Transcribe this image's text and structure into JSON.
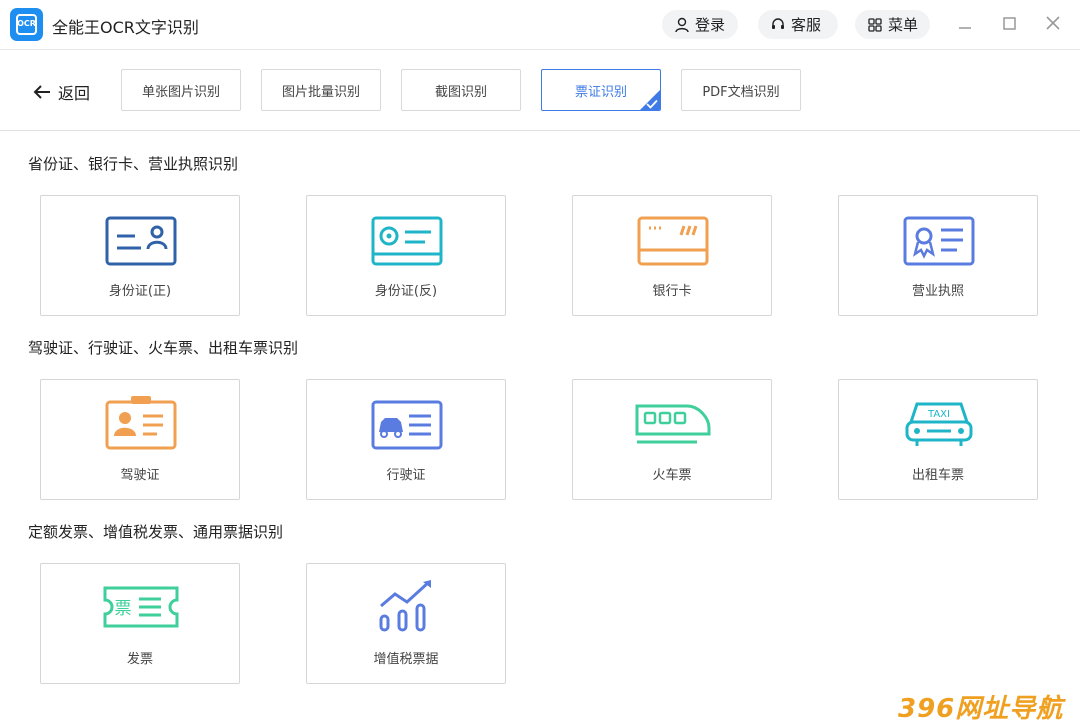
{
  "app": {
    "title": "全能王OCR文字识别",
    "logo_text": "OCR",
    "login_label": "登录",
    "service_label": "客服",
    "menu_label": "菜单"
  },
  "toolbar": {
    "back_label": "返回",
    "tabs": [
      {
        "label": "单张图片识别",
        "active": false
      },
      {
        "label": "图片批量识别",
        "active": false
      },
      {
        "label": "截图识别",
        "active": false
      },
      {
        "label": "票证识别",
        "active": true
      },
      {
        "label": "PDF文档识别",
        "active": false
      }
    ]
  },
  "sections": [
    {
      "title": "省份证、银行卡、营业执照识别",
      "cards": [
        {
          "label": "身份证(正)",
          "icon": "id-card-front-icon",
          "color": "#2f62a8"
        },
        {
          "label": "身份证(反)",
          "icon": "id-card-back-icon",
          "color": "#1fb5c8"
        },
        {
          "label": "银行卡",
          "icon": "bank-card-icon",
          "color": "#f0a050"
        },
        {
          "label": "营业执照",
          "icon": "business-license-icon",
          "color": "#5a7be0"
        }
      ]
    },
    {
      "title": "驾驶证、行驶证、火车票、出租车票识别",
      "cards": [
        {
          "label": "驾驶证",
          "icon": "driver-license-icon",
          "color": "#f0a050"
        },
        {
          "label": "行驶证",
          "icon": "vehicle-license-icon",
          "color": "#5a7be0"
        },
        {
          "label": "火车票",
          "icon": "train-ticket-icon",
          "color": "#3ecf9a"
        },
        {
          "label": "出租车票",
          "icon": "taxi-ticket-icon",
          "color": "#1fb5c8",
          "icon_text": "TAXI"
        }
      ]
    },
    {
      "title": "定额发票、增值税发票、通用票据识别",
      "cards": [
        {
          "label": "发票",
          "icon": "invoice-icon",
          "color": "#3ecf9a",
          "icon_text": "票"
        },
        {
          "label": "增值税票据",
          "icon": "vat-invoice-icon",
          "color": "#5a7be0"
        }
      ]
    }
  ],
  "watermark": "396网址导航"
}
